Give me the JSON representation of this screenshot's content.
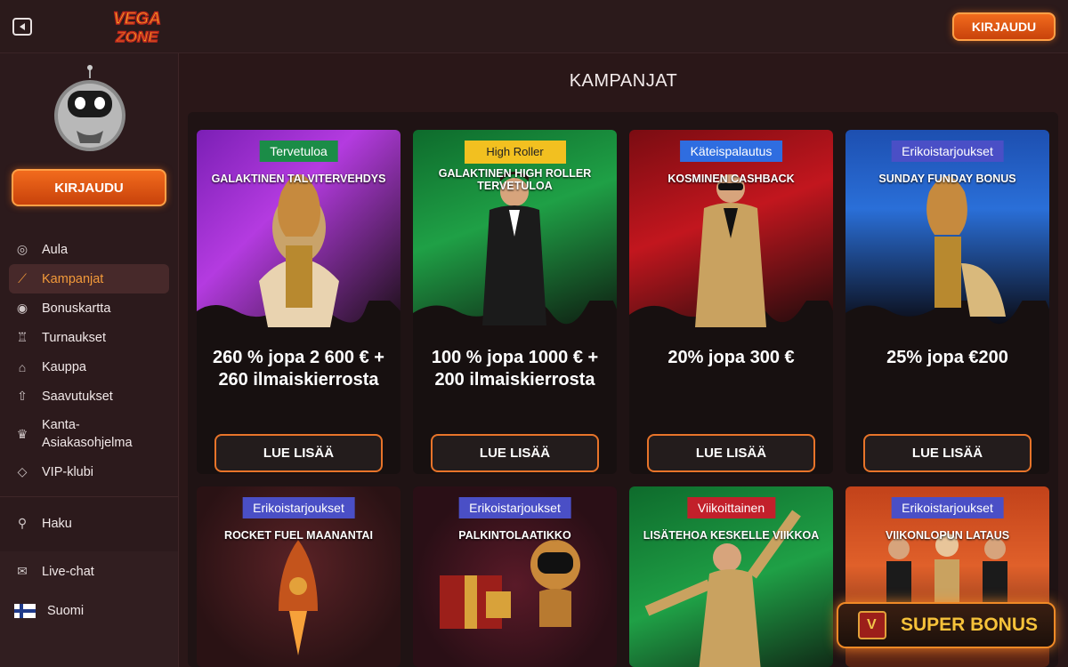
{
  "header": {
    "logo_text": "VEGA ZONE",
    "login_label": "KIRJAUDU"
  },
  "sidebar": {
    "login_label": "KIRJAUDU",
    "items": [
      {
        "label": "Aula",
        "icon": "planet-icon"
      },
      {
        "label": "Kampanjat",
        "icon": "telescope-icon",
        "active": true
      },
      {
        "label": "Bonuskartta",
        "icon": "target-icon"
      },
      {
        "label": "Turnaukset",
        "icon": "trophy-icon"
      },
      {
        "label": "Kauppa",
        "icon": "shop-icon"
      },
      {
        "label": "Saavutukset",
        "icon": "rocket-icon"
      },
      {
        "label": "Kanta-Asiakasohjelma",
        "icon": "crown-icon"
      },
      {
        "label": "VIP-klubi",
        "icon": "diamond-icon"
      }
    ],
    "search_label": "Haku",
    "chat_label": "Live-chat",
    "language_label": "Suomi"
  },
  "main": {
    "title": "KAMPANJAT",
    "cards": [
      {
        "tag": "Tervetuloa",
        "name": "GALAKTINEN TALVITERVEHDYS",
        "offer": "260 % jopa 2 600 € + 260 ilmaiskierrosta",
        "button": "LUE LISÄÄ"
      },
      {
        "tag": "High Roller",
        "name": "GALAKTINEN HIGH ROLLER TERVETULOA",
        "offer": "100 % jopa 1000 € + 200 ilmaiskierrosta",
        "button": "LUE LISÄÄ"
      },
      {
        "tag": "Käteispalautus",
        "name": "KOSMINEN CASHBACK",
        "offer": "20% jopa 300 €",
        "button": "LUE LISÄÄ"
      },
      {
        "tag": "Erikoistarjoukset",
        "name": "SUNDAY FUNDAY BONUS",
        "offer": "25% jopa €200",
        "button": "LUE LISÄÄ"
      },
      {
        "tag": "Erikoistarjoukset",
        "name": "ROCKET FUEL MAANANTAI"
      },
      {
        "tag": "Erikoistarjoukset",
        "name": "PALKINTOLAATIKKO"
      },
      {
        "tag": "Viikoittainen",
        "name": "LISÄTEHOA KESKELLE VIIKKOA"
      },
      {
        "tag": "Erikoistarjoukset",
        "name": "VIIKONLOPUN LATAUS"
      }
    ]
  },
  "super_bonus": {
    "label": "SUPER BONUS"
  }
}
